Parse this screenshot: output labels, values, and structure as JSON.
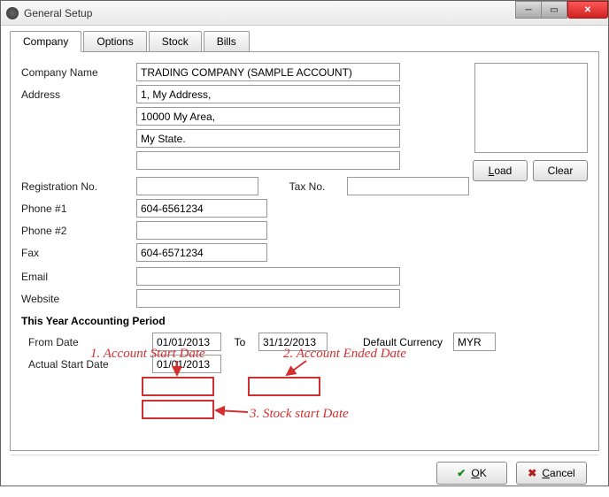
{
  "window": {
    "title": "General Setup"
  },
  "tabs": {
    "company": "Company",
    "options": "Options",
    "stock": "Stock",
    "bills": "Bills"
  },
  "labels": {
    "company_name": "Company Name",
    "address": "Address",
    "registration_no": "Registration No.",
    "tax_no": "Tax No.",
    "phone1": "Phone #1",
    "phone2": "Phone #2",
    "fax": "Fax",
    "email": "Email",
    "website": "Website",
    "section": "This Year Accounting Period",
    "from_date": "From Date",
    "to": "To",
    "actual_start": "Actual Start Date",
    "default_currency": "Default Currency"
  },
  "fields": {
    "company_name": "TRADING COMPANY (SAMPLE ACCOUNT)",
    "address1": "1, My Address,",
    "address2": "10000 My Area,",
    "address3": "My State.",
    "address4": "",
    "registration_no": "",
    "tax_no": "",
    "phone1": "604-6561234",
    "phone2": "",
    "fax": "604-6571234",
    "email": "",
    "website": "",
    "from_date": "01/01/2013",
    "to_date": "31/12/2013",
    "actual_start": "01/01/2013",
    "default_currency": "MYR"
  },
  "buttons": {
    "load": "Load",
    "clear": "Clear",
    "ok": "OK",
    "cancel": "Cancel"
  },
  "annotations": {
    "a1": "1. Account Start Date",
    "a2": "2. Account Ended Date",
    "a3": "3. Stock start Date"
  }
}
